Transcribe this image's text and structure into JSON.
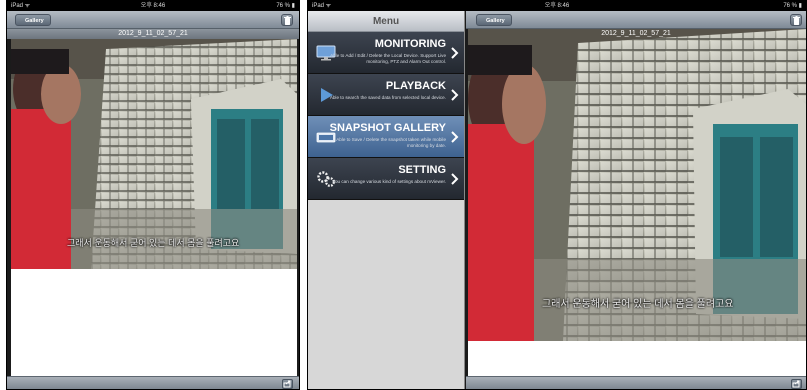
{
  "left_device": {
    "statusbar": {
      "left": "iPad ᯤ",
      "center": "오후 8:46",
      "right": "76 % ▮"
    },
    "nav": {
      "back_label": "Gallery"
    },
    "title": "2012_9_11_02_57_21",
    "subtitle": "그래서 운동해서 굳어 있는 데서 몸을 풀려고요"
  },
  "right_device": {
    "statusbar": {
      "left": "iPad ᯤ",
      "center": "오후 8:46",
      "right": "76 % ▮"
    },
    "menu": {
      "header": "Menu",
      "items": [
        {
          "title": "MONITORING",
          "desc": "Able to Add / Edit / Delete the Local Device. Support Live monitoring, PTZ and Alarm Out control.",
          "icon": "monitor-icon",
          "selected": false
        },
        {
          "title": "PLAYBACK",
          "desc": "Able to search the saved data from selected local device.",
          "icon": "play-icon",
          "selected": false
        },
        {
          "title": "SNAPSHOT GALLERY",
          "desc": "Able to Save / Delete the snapshot taken while mobile monitoring by date.",
          "icon": "gallery-icon",
          "selected": true
        },
        {
          "title": "SETTING",
          "desc": "You can change various kind of settings about mViewer.",
          "icon": "gears-icon",
          "selected": false
        }
      ]
    },
    "nav": {
      "back_label": "Gallery"
    },
    "title": "2012_9_11_02_57_21",
    "subtitle": "그래서 운동해서 굳어 있는 데서 몸을 풀려고요"
  },
  "colors": {
    "selected_item": "#4f73a3",
    "menu_item": "#2e343d",
    "navbar": "#8f99a3",
    "door": "#2c7e84"
  },
  "icons": {
    "trash": "trash-icon",
    "share": "share-icon",
    "chevron": "chevron-right-icon"
  }
}
